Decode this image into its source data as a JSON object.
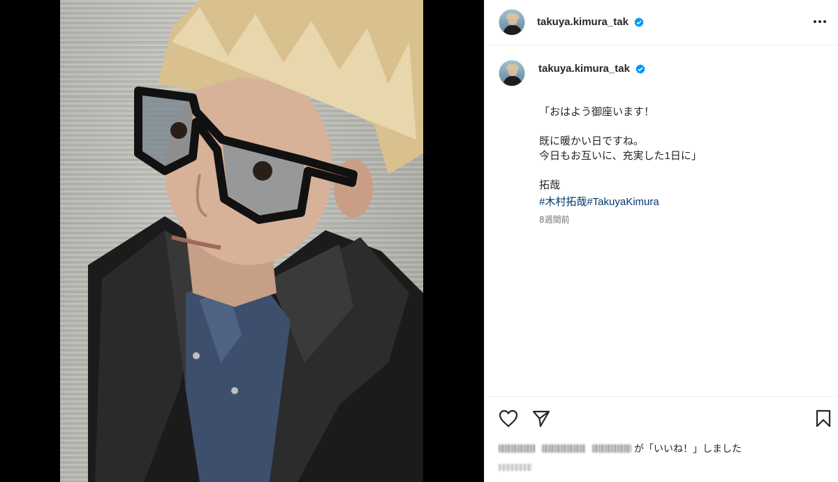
{
  "post": {
    "username": "takuya.kimura_tak",
    "verified": true,
    "more_icon": "more-horizontal-icon"
  },
  "caption": {
    "username": "takuya.kimura_tak",
    "lines": [
      "「おはよう御座います！",
      "",
      "既に暖かい日ですね。",
      "今日もお互いに、充実した1日に」",
      "",
      "拓哉"
    ],
    "hashtags": [
      "#木村拓哉",
      "#TakuyaKimura"
    ],
    "time": "8週間前"
  },
  "actions": {
    "icons": [
      "heart-icon",
      "share-icon",
      "bookmark-icon"
    ],
    "liked_by_suffix": "が「いいね！」しました"
  },
  "colors": {
    "verified_badge": "#0095f6",
    "hashtag": "#00376b",
    "media_bg": "#000000"
  }
}
